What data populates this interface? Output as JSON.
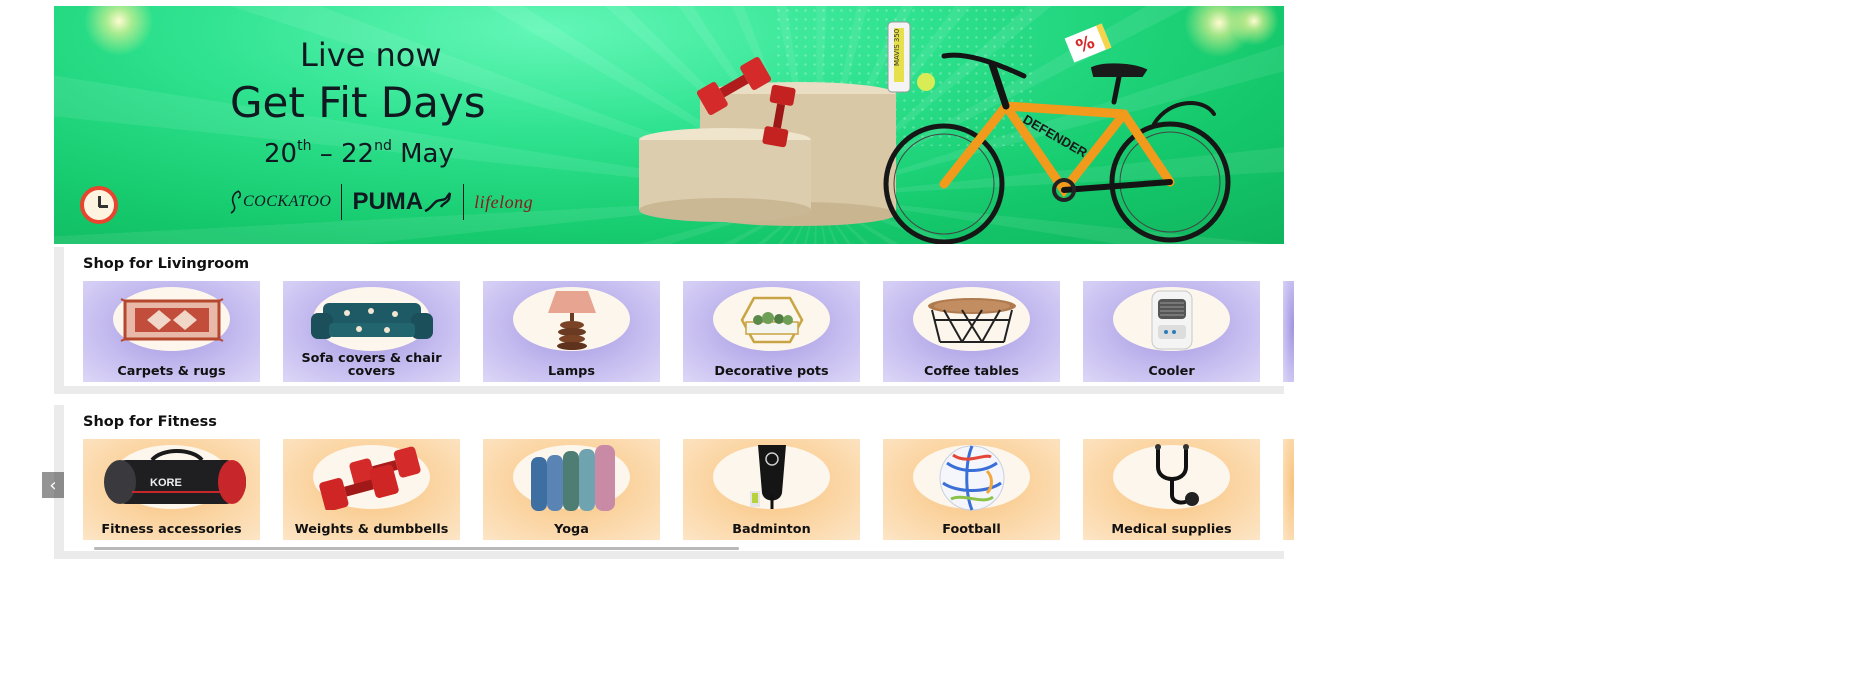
{
  "banner": {
    "live": "Live now",
    "title": "Get Fit Days",
    "date_start": "20",
    "date_start_suffix": "th",
    "date_sep": " – ",
    "date_end": "22",
    "date_end_suffix": "nd",
    "date_month": " May",
    "brands": [
      "COCKATOO",
      "PUMA",
      "lifelong"
    ],
    "sale_tag": "%",
    "bike_brand": "DEFENDER",
    "accent_colors": {
      "background": "#1fd27a",
      "text": "#101820",
      "lifelong": "#8b1a1a"
    }
  },
  "sections": [
    {
      "title": "Shop for Livingroom",
      "theme": "purple",
      "items": [
        {
          "label": "Carpets & rugs",
          "icon": "carpet-icon"
        },
        {
          "label": "Sofa covers & chair covers",
          "icon": "sofa-icon"
        },
        {
          "label": "Lamps",
          "icon": "lamp-icon"
        },
        {
          "label": "Decorative pots",
          "icon": "planter-icon"
        },
        {
          "label": "Coffee tables",
          "icon": "table-icon"
        },
        {
          "label": "Cooler",
          "icon": "cooler-icon"
        }
      ]
    },
    {
      "title": "Shop for Fitness",
      "theme": "orange",
      "items": [
        {
          "label": "Fitness accessories",
          "icon": "gym-bag-icon"
        },
        {
          "label": "Weights & dumbbells",
          "icon": "dumbbell-icon"
        },
        {
          "label": "Yoga",
          "icon": "yoga-mat-icon"
        },
        {
          "label": "Badminton",
          "icon": "racket-bag-icon"
        },
        {
          "label": "Football",
          "icon": "football-icon"
        },
        {
          "label": "Medical supplies",
          "icon": "stethoscope-icon"
        }
      ]
    }
  ],
  "fitness_scroll_prev": "‹",
  "gym_bag_brand": "KORE"
}
